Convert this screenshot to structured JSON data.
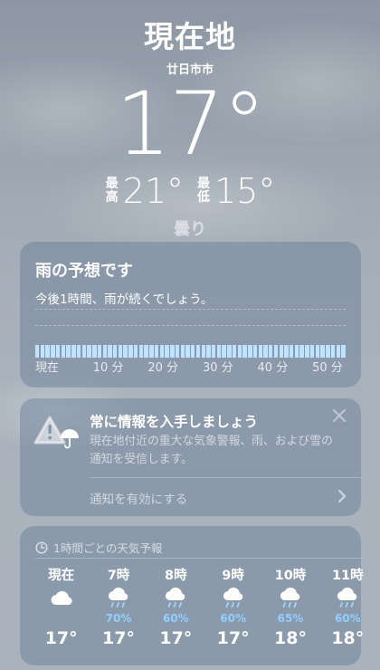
{
  "header": {
    "location": "現在地",
    "sublocation": "廿日市市",
    "temperature": "17°",
    "high_label": "最高",
    "high": "21°",
    "low_label": "最低",
    "low": "15°",
    "condition": "曇り"
  },
  "rain_card": {
    "title": "雨の予想です",
    "subtitle": "今後1時間、雨が続くでしょう。",
    "axis": [
      "現在",
      "10 分",
      "20 分",
      "30 分",
      "40 分",
      "50 分"
    ],
    "intensity_level": "light",
    "bar_color": "#bfe3ff"
  },
  "alert_card": {
    "title": "常に情報を入手しましょう",
    "body": "現在地付近の重大な気象警報、雨、および雪の通知を受信します。",
    "link": "通知を有効にする",
    "icons": [
      "warning-umbrella-icon",
      "close-icon",
      "chevron-right-icon"
    ]
  },
  "hourly": {
    "header": "1時間ごとの天気予報",
    "header_icon": "clock-icon",
    "hours": [
      {
        "time": "現在",
        "icon": "cloud-icon",
        "precip": "",
        "temp": "17°"
      },
      {
        "time": "7時",
        "icon": "cloud-rain-icon",
        "precip": "70%",
        "temp": "17°"
      },
      {
        "time": "8時",
        "icon": "cloud-rain-icon",
        "precip": "60%",
        "temp": "17°"
      },
      {
        "time": "9時",
        "icon": "cloud-rain-icon",
        "precip": "60%",
        "temp": "17°"
      },
      {
        "time": "10時",
        "icon": "cloud-rain-icon",
        "precip": "65%",
        "temp": "18°"
      },
      {
        "time": "11時",
        "icon": "cloud-rain-icon",
        "precip": "60%",
        "temp": "18°"
      }
    ]
  },
  "colors": {
    "precip_text": "#8fd0ff"
  }
}
